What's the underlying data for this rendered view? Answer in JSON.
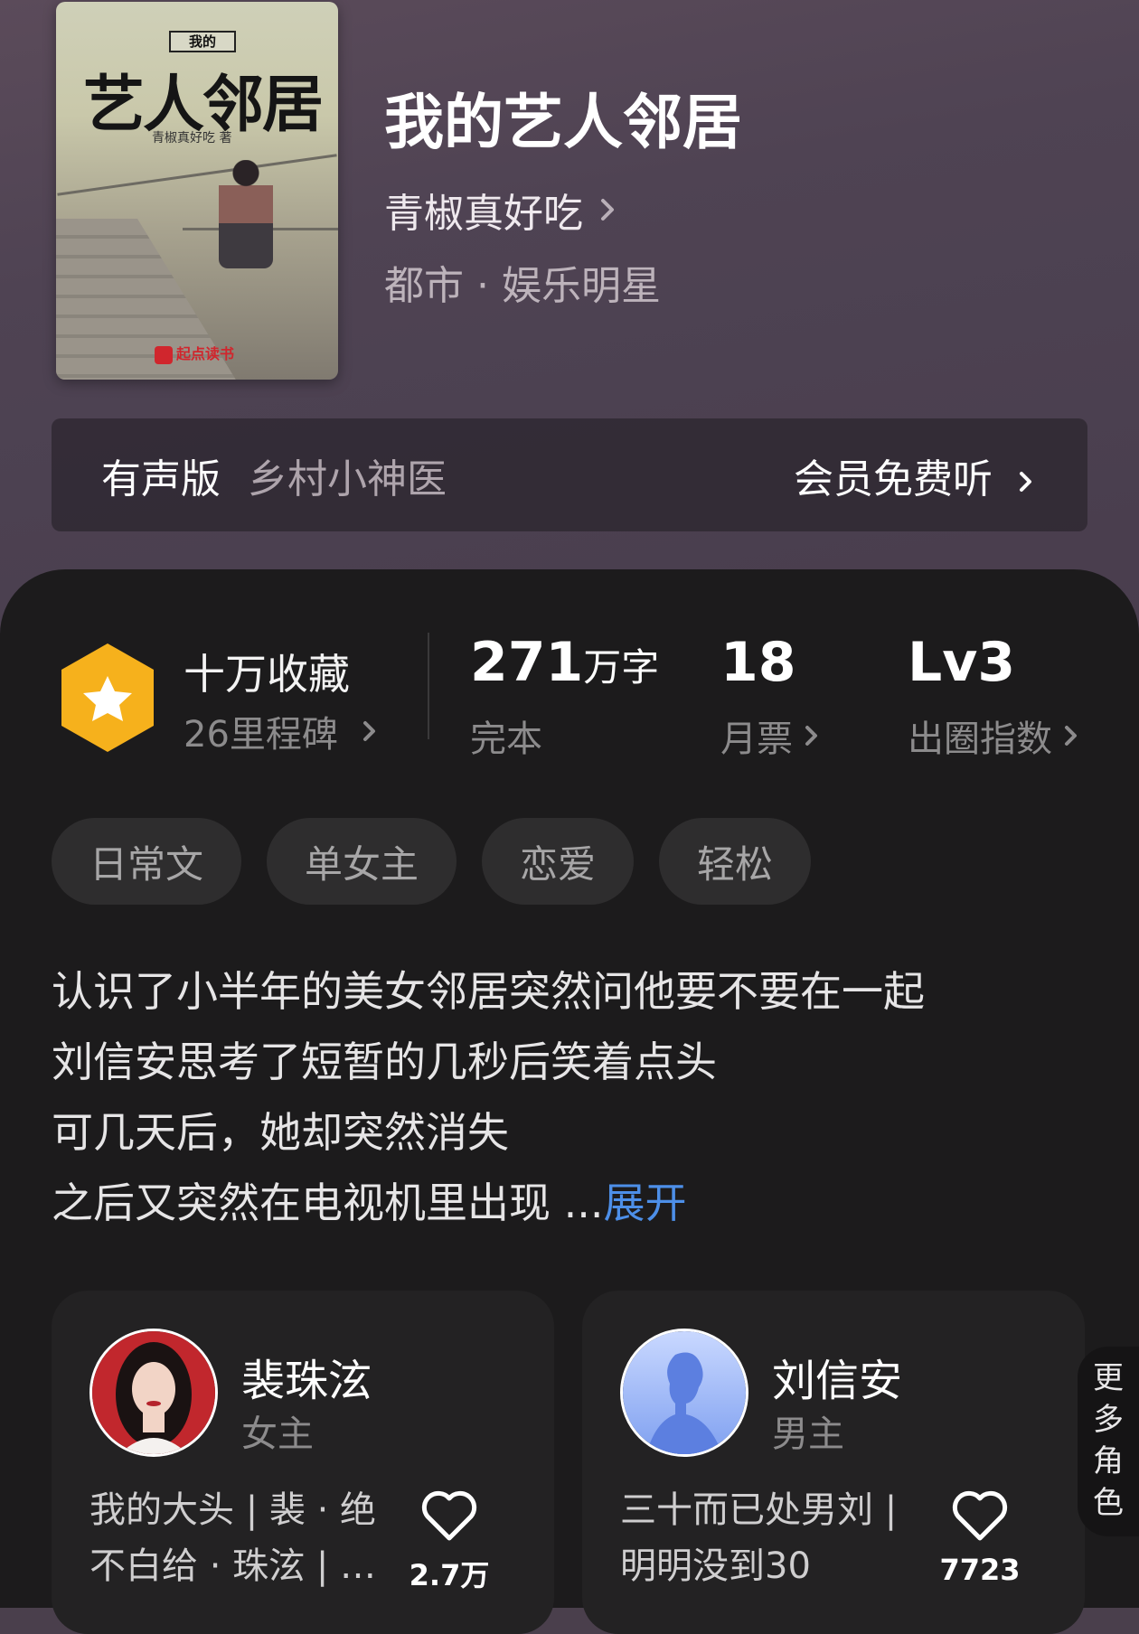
{
  "book": {
    "cover": {
      "series_text": "我的",
      "title": "艺人邻居",
      "author": "青椒真好吃 著",
      "publisher": "起点读书"
    },
    "title": "我的艺人邻居",
    "author": "青椒真好吃",
    "genre": "都市 · 娱乐明星"
  },
  "audio": {
    "label": "有声版",
    "name": "乡村小神医",
    "cta": "会员免费听"
  },
  "stats": {
    "favorites": {
      "title": "十万收藏",
      "sub": "26里程碑"
    },
    "words": {
      "value": "271",
      "unit": "万字",
      "status": "完本"
    },
    "tickets": {
      "value": "18",
      "label": "月票"
    },
    "index": {
      "value": "Lv3",
      "label": "出圈指数"
    }
  },
  "tags": [
    "日常文",
    "单女主",
    "恋爱",
    "轻松"
  ],
  "synopsis": {
    "lines": [
      "认识了小半年的美女邻居突然问他要不要在一起",
      "刘信安思考了短暂的几秒后笑着点头",
      "可几天后，她却突然消失",
      "之后又突然在电视机里出现 ..."
    ],
    "expand": "展开"
  },
  "characters": [
    {
      "name": "裴珠泫",
      "role": "女主",
      "desc_lines": [
        "我的大头 | 裴 · 绝",
        "不白给 · 珠泫 | …"
      ],
      "likes": "2.7万"
    },
    {
      "name": "刘信安",
      "role": "男主",
      "desc_lines": [
        "三十而已处男刘 |",
        "明明没到30"
      ],
      "likes": "7723"
    }
  ],
  "more_roles": [
    "更",
    "多",
    "角",
    "色"
  ],
  "colors": {
    "accent_blue": "#4d8fe8",
    "badge_orange": "#f6b11c",
    "panel_bg": "#1c1b1c"
  }
}
